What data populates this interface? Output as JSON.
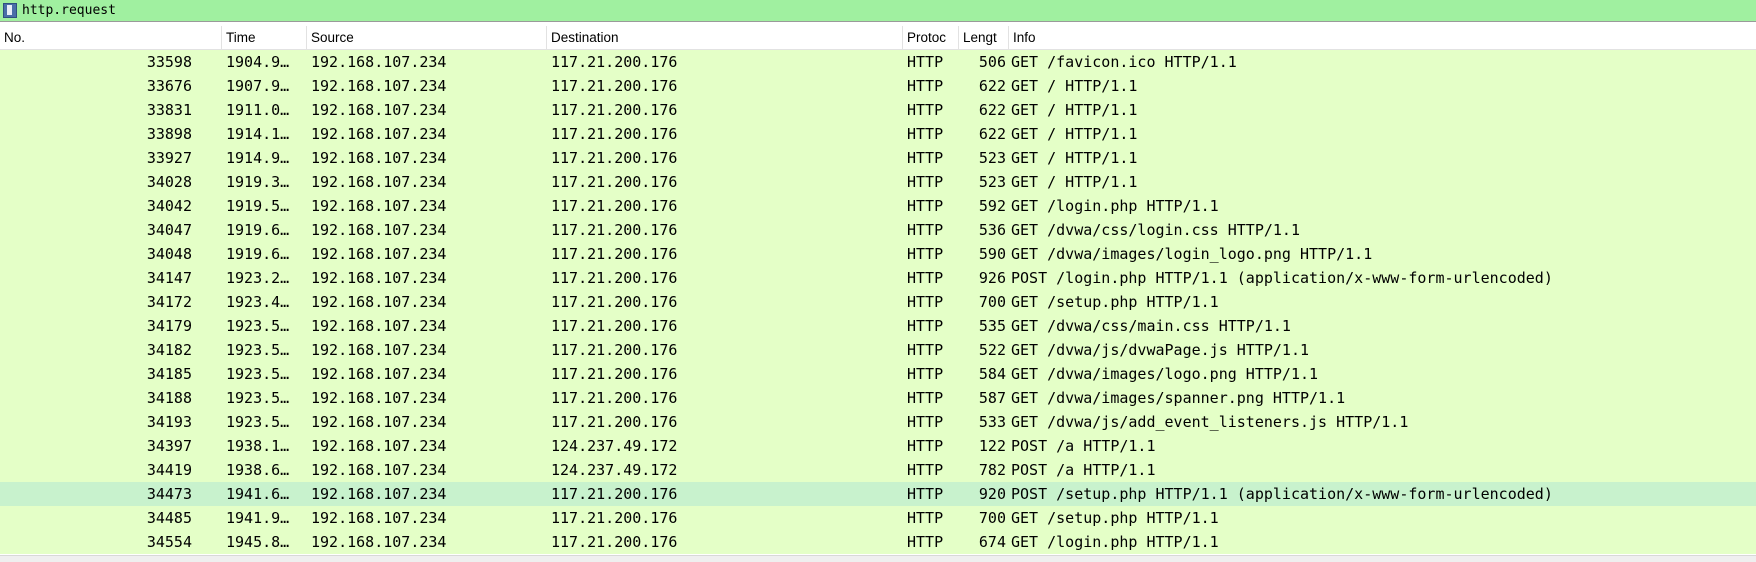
{
  "filter": {
    "value": "http.request"
  },
  "columns": {
    "no": "No.",
    "time": "Time",
    "source": "Source",
    "destination": "Destination",
    "protocol": "Protoc",
    "length": "Lengt",
    "info": "Info"
  },
  "packets": [
    {
      "no": "33598",
      "time": "1904.9…",
      "src": "192.168.107.234",
      "dst": "117.21.200.176",
      "proto": "HTTP",
      "len": "506",
      "info": "GET /favicon.ico HTTP/1.1"
    },
    {
      "no": "33676",
      "time": "1907.9…",
      "src": "192.168.107.234",
      "dst": "117.21.200.176",
      "proto": "HTTP",
      "len": "622",
      "info": "GET / HTTP/1.1"
    },
    {
      "no": "33831",
      "time": "1911.0…",
      "src": "192.168.107.234",
      "dst": "117.21.200.176",
      "proto": "HTTP",
      "len": "622",
      "info": "GET / HTTP/1.1"
    },
    {
      "no": "33898",
      "time": "1914.1…",
      "src": "192.168.107.234",
      "dst": "117.21.200.176",
      "proto": "HTTP",
      "len": "622",
      "info": "GET / HTTP/1.1"
    },
    {
      "no": "33927",
      "time": "1914.9…",
      "src": "192.168.107.234",
      "dst": "117.21.200.176",
      "proto": "HTTP",
      "len": "523",
      "info": "GET / HTTP/1.1"
    },
    {
      "no": "34028",
      "time": "1919.3…",
      "src": "192.168.107.234",
      "dst": "117.21.200.176",
      "proto": "HTTP",
      "len": "523",
      "info": "GET / HTTP/1.1"
    },
    {
      "no": "34042",
      "time": "1919.5…",
      "src": "192.168.107.234",
      "dst": "117.21.200.176",
      "proto": "HTTP",
      "len": "592",
      "info": "GET /login.php HTTP/1.1"
    },
    {
      "no": "34047",
      "time": "1919.6…",
      "src": "192.168.107.234",
      "dst": "117.21.200.176",
      "proto": "HTTP",
      "len": "536",
      "info": "GET /dvwa/css/login.css HTTP/1.1"
    },
    {
      "no": "34048",
      "time": "1919.6…",
      "src": "192.168.107.234",
      "dst": "117.21.200.176",
      "proto": "HTTP",
      "len": "590",
      "info": "GET /dvwa/images/login_logo.png HTTP/1.1"
    },
    {
      "no": "34147",
      "time": "1923.2…",
      "src": "192.168.107.234",
      "dst": "117.21.200.176",
      "proto": "HTTP",
      "len": "926",
      "info": "POST /login.php HTTP/1.1  (application/x-www-form-urlencoded)"
    },
    {
      "no": "34172",
      "time": "1923.4…",
      "src": "192.168.107.234",
      "dst": "117.21.200.176",
      "proto": "HTTP",
      "len": "700",
      "info": "GET /setup.php HTTP/1.1"
    },
    {
      "no": "34179",
      "time": "1923.5…",
      "src": "192.168.107.234",
      "dst": "117.21.200.176",
      "proto": "HTTP",
      "len": "535",
      "info": "GET /dvwa/css/main.css HTTP/1.1"
    },
    {
      "no": "34182",
      "time": "1923.5…",
      "src": "192.168.107.234",
      "dst": "117.21.200.176",
      "proto": "HTTP",
      "len": "522",
      "info": "GET /dvwa/js/dvwaPage.js HTTP/1.1"
    },
    {
      "no": "34185",
      "time": "1923.5…",
      "src": "192.168.107.234",
      "dst": "117.21.200.176",
      "proto": "HTTP",
      "len": "584",
      "info": "GET /dvwa/images/logo.png HTTP/1.1"
    },
    {
      "no": "34188",
      "time": "1923.5…",
      "src": "192.168.107.234",
      "dst": "117.21.200.176",
      "proto": "HTTP",
      "len": "587",
      "info": "GET /dvwa/images/spanner.png HTTP/1.1"
    },
    {
      "no": "34193",
      "time": "1923.5…",
      "src": "192.168.107.234",
      "dst": "117.21.200.176",
      "proto": "HTTP",
      "len": "533",
      "info": "GET /dvwa/js/add_event_listeners.js HTTP/1.1"
    },
    {
      "no": "34397",
      "time": "1938.1…",
      "src": "192.168.107.234",
      "dst": "124.237.49.172",
      "proto": "HTTP",
      "len": "122",
      "info": "POST /a HTTP/1.1"
    },
    {
      "no": "34419",
      "time": "1938.6…",
      "src": "192.168.107.234",
      "dst": "124.237.49.172",
      "proto": "HTTP",
      "len": "782",
      "info": "POST /a HTTP/1.1"
    },
    {
      "no": "34473",
      "time": "1941.6…",
      "src": "192.168.107.234",
      "dst": "117.21.200.176",
      "proto": "HTTP",
      "len": "920",
      "info": "POST /setup.php HTTP/1.1  (application/x-www-form-urlencoded)",
      "selected": true
    },
    {
      "no": "34485",
      "time": "1941.9…",
      "src": "192.168.107.234",
      "dst": "117.21.200.176",
      "proto": "HTTP",
      "len": "700",
      "info": "GET /setup.php HTTP/1.1"
    },
    {
      "no": "34554",
      "time": "1945.8…",
      "src": "192.168.107.234",
      "dst": "117.21.200.176",
      "proto": "HTTP",
      "len": "674",
      "info": "GET /login.php HTTP/1.1"
    }
  ],
  "colors": {
    "filter_bg": "#a0f0a0",
    "row_bg": "#e4ffc7",
    "selected_row_bg": "#c8f2cd"
  }
}
